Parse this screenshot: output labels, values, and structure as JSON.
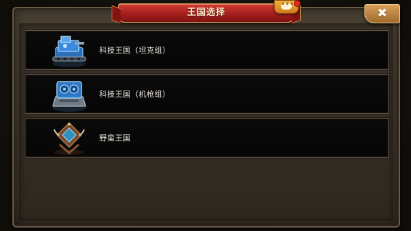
{
  "dialog": {
    "title": "王国选择",
    "close_label": "✖",
    "chat_dots": "•••"
  },
  "kingdoms": [
    {
      "label": "科技王国（坦克组）",
      "icon": "blue-tank-icon"
    },
    {
      "label": "科技王国（机枪组）",
      "icon": "blue-turret-icon"
    },
    {
      "label": "野蛮王国",
      "icon": "barbarian-totem-icon"
    }
  ],
  "colors": {
    "ribbon": "#c02a27",
    "close_button": "#c48a48",
    "row_bg": "#080808",
    "row_text": "#f1ebe2",
    "dialog_frame": "#4a4134"
  }
}
